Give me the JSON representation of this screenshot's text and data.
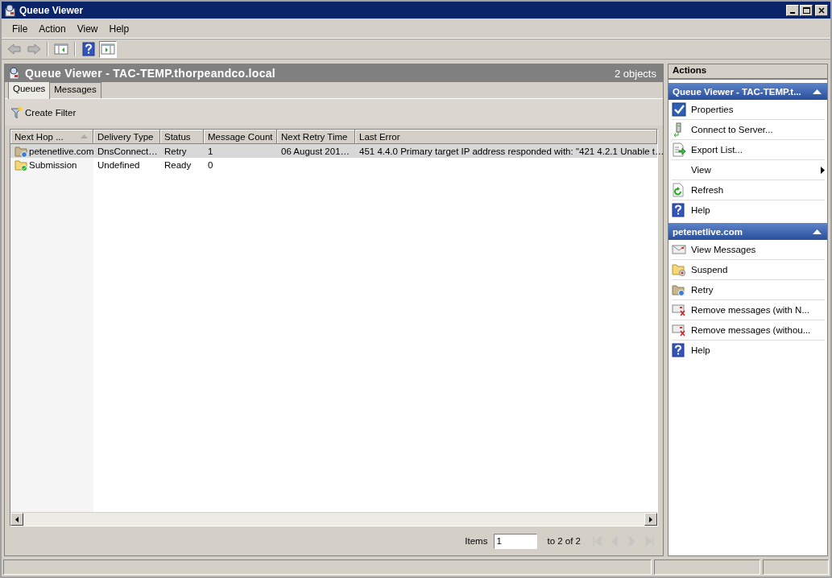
{
  "window": {
    "title": "Queue Viewer"
  },
  "menu": [
    "File",
    "Action",
    "View",
    "Help"
  ],
  "toolbar": [
    {
      "kind": "back",
      "pressed": false
    },
    {
      "kind": "forward",
      "pressed": false
    },
    {
      "kind": "console-tree",
      "pressed": false
    },
    {
      "kind": "help",
      "pressed": false
    },
    {
      "kind": "action-pane",
      "pressed": true
    }
  ],
  "result_pane": {
    "title": "Queue Viewer - TAC-TEMP.thorpeandco.local",
    "count": "2 objects",
    "tabs": [
      {
        "label": "Queues",
        "selected": true
      },
      {
        "label": "Messages",
        "selected": false
      }
    ],
    "filter_button": "Create Filter",
    "table": {
      "columns": [
        {
          "label": "Next Hop ...",
          "sorted": true
        },
        {
          "label": "Delivery Type",
          "sorted": false
        },
        {
          "label": "Status",
          "sorted": false
        },
        {
          "label": "Message Count",
          "sorted": false
        },
        {
          "label": "Next Retry Time",
          "sorted": false
        },
        {
          "label": "Last Error",
          "sorted": false
        }
      ],
      "rows": [
        {
          "kind": "retry",
          "selected": true,
          "cells": [
            "petenetlive.com",
            "DnsConnect…",
            "Retry",
            "1",
            "06 August 201…",
            "451 4.4.0 Primary target IP address responded with: \"421 4.2.1 Unable t…"
          ]
        },
        {
          "kind": "ready",
          "selected": false,
          "cells": [
            "Submission",
            "Undefined",
            "Ready",
            "0",
            "",
            ""
          ]
        }
      ]
    },
    "pagination": {
      "label": "Items",
      "value": "1",
      "range": "to 2 of 2",
      "nav_disabled": true
    }
  },
  "actions": {
    "title": "Actions",
    "sections": [
      {
        "title": "Queue Viewer - TAC-TEMP.t...",
        "expanded": true,
        "items": [
          {
            "label": "Properties",
            "kind": "properties",
            "submenu": false
          },
          {
            "label": "Connect to Server...",
            "kind": "server",
            "submenu": false
          },
          {
            "label": "Export List...",
            "kind": "export",
            "submenu": false
          },
          {
            "label": "View",
            "kind": "plain",
            "submenu": true
          },
          {
            "label": "Refresh",
            "kind": "refresh",
            "submenu": false
          },
          {
            "label": "Help",
            "kind": "help",
            "submenu": false
          }
        ]
      },
      {
        "title": "petenetlive.com",
        "expanded": true,
        "items": [
          {
            "label": "View Messages",
            "kind": "mail",
            "submenu": false
          },
          {
            "label": "Suspend",
            "kind": "suspend",
            "submenu": false
          },
          {
            "label": "Retry",
            "kind": "retry",
            "submenu": false
          },
          {
            "label": "Remove messages (with N...",
            "kind": "remove",
            "submenu": false
          },
          {
            "label": "Remove messages (withou...",
            "kind": "remove",
            "submenu": false
          },
          {
            "label": "Help",
            "kind": "help",
            "submenu": false
          }
        ]
      }
    ]
  }
}
